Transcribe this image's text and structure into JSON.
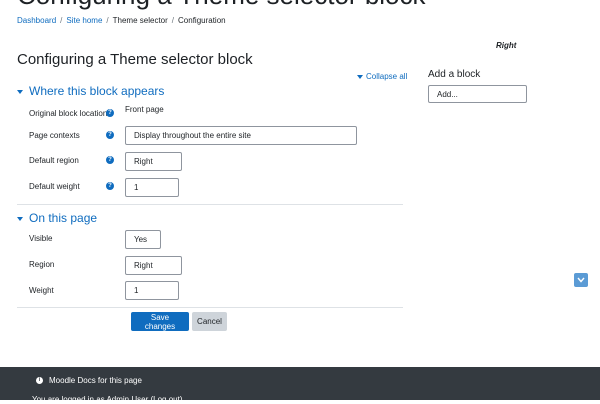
{
  "header": {
    "title": "Configuring a Theme selector block"
  },
  "breadcrumb": {
    "items": [
      "Dashboard",
      "Site home",
      "Theme selector",
      "Configuration"
    ],
    "separator": "/"
  },
  "region_label": "Right",
  "page_title": "Configuring a Theme selector block",
  "collapse_all": "Collapse all",
  "section1": {
    "title": "Where this block appears",
    "original_location_label": "Original block location",
    "original_location_value": "Front page",
    "page_contexts_label": "Page contexts",
    "page_contexts_value": "Display throughout the entire site",
    "default_region_label": "Default region",
    "default_region_value": "Right",
    "default_weight_label": "Default weight",
    "default_weight_value": "1"
  },
  "section2": {
    "title": "On this page",
    "visible_label": "Visible",
    "visible_value": "Yes",
    "region_label": "Region",
    "region_value": "Right",
    "weight_label": "Weight",
    "weight_value": "1"
  },
  "buttons": {
    "save": "Save changes",
    "cancel": "Cancel"
  },
  "add_block": {
    "title": "Add a block",
    "placeholder": "Add..."
  },
  "footer": {
    "docs_link": "Moodle Docs for this page",
    "logged_in_text": "You are logged in as ",
    "user": "Admin User",
    "logout": "(Log out)"
  },
  "colors": {
    "accent": "#0f6cbf",
    "footer_bg": "#343a40"
  }
}
